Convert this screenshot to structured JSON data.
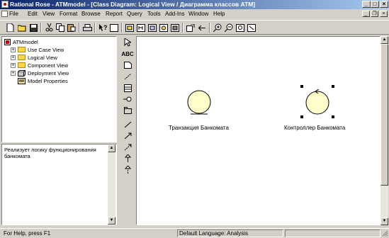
{
  "window": {
    "title": "Rational Rose - ATMmodel - [Class Diagram: Logical View / Диаграмма классов ATM]"
  },
  "menu": [
    "File",
    "Edit",
    "View",
    "Format",
    "Browse",
    "Report",
    "Query",
    "Tools",
    "Add-Ins",
    "Window",
    "Help"
  ],
  "browser": {
    "root": "ATMmodel",
    "items": [
      {
        "label": "Use Case View"
      },
      {
        "label": "Logical View"
      },
      {
        "label": "Component View"
      },
      {
        "label": "Deployment View"
      },
      {
        "label": "Model Properties"
      }
    ]
  },
  "documentation": "Реализует логику функционирования банкомата",
  "diagram": {
    "classes": [
      {
        "name": "Транзакция Банкомата"
      },
      {
        "name": "Контроллер Банкомата"
      }
    ]
  },
  "status": {
    "help": "For Help, press F1",
    "language": "Default Language: Analysis"
  },
  "icons": {
    "toolbar": [
      "new-icon",
      "open-icon",
      "save-icon",
      "cut-icon",
      "copy-icon",
      "paste-icon",
      "print-icon",
      "context-help-icon",
      "view-doc-icon",
      "browse-class-icon",
      "browse-interaction-icon",
      "browse-component-icon",
      "browse-deployment-icon",
      "browse-parent-icon",
      "browse-previous-icon",
      "zoom-in-icon",
      "zoom-out-icon",
      "fit-window-icon",
      "undo-fit-icon"
    ],
    "toolbox": [
      "selection-icon",
      "text-icon",
      "note-icon",
      "anchor-icon",
      "class-icon",
      "interface-icon",
      "package-icon",
      "association-icon",
      "unidirectional-icon",
      "dependency-icon",
      "generalization-icon",
      "realize-icon"
    ]
  },
  "colors": {
    "title_start": "#0a246a",
    "title_end": "#a6caf0",
    "class_fill": "#ffffcc",
    "folder": "#ffd84a"
  }
}
